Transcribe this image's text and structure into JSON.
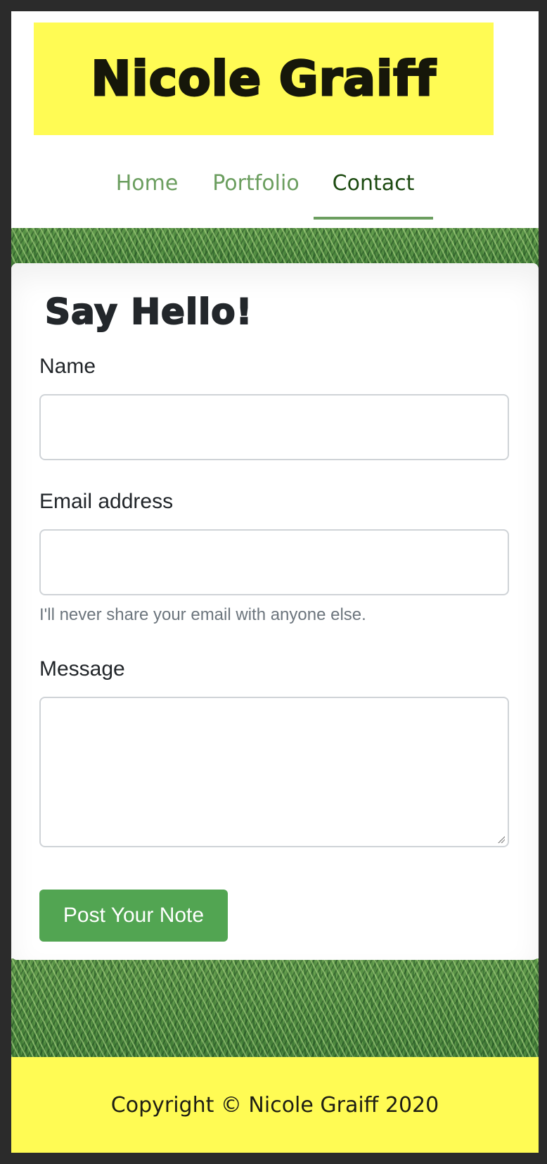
{
  "header": {
    "site_title": "Nicole Graiff"
  },
  "nav": {
    "items": [
      {
        "label": "Home",
        "active": false
      },
      {
        "label": "Portfolio",
        "active": false
      },
      {
        "label": "Contact",
        "active": true
      }
    ]
  },
  "form": {
    "heading": "Say Hello!",
    "name_label": "Name",
    "name_value": "",
    "email_label": "Email address",
    "email_value": "",
    "email_help": "I'll never share your email with anyone else.",
    "message_label": "Message",
    "message_value": "",
    "submit_label": "Post Your Note"
  },
  "footer": {
    "copyright": "Copyright © Nicole Graiff 2020"
  },
  "colors": {
    "banner_yellow": "#fffb54",
    "nav_green": "#6b9e5f",
    "nav_active": "#1c4a10",
    "button_green": "#52a552"
  }
}
